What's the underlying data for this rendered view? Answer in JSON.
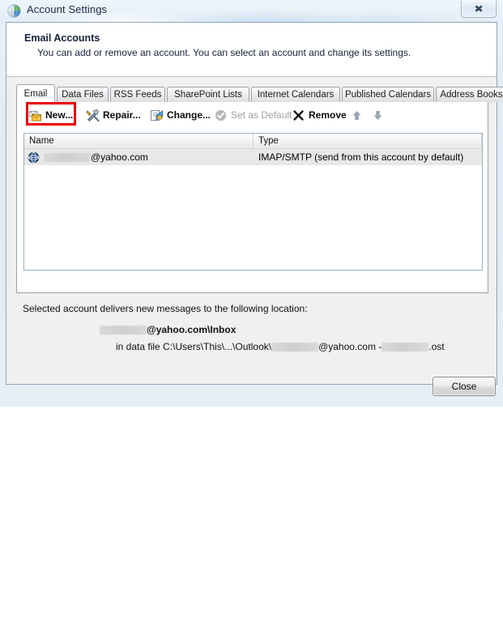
{
  "window": {
    "title": "Account Settings",
    "icon": "outlook-account-settings-icon",
    "close_glyph": "✖"
  },
  "header": {
    "title": "Email Accounts",
    "description": "You can add or remove an account. You can select an account and change its settings."
  },
  "tabs": [
    {
      "label": "Email",
      "selected": true
    },
    {
      "label": "Data Files",
      "selected": false
    },
    {
      "label": "RSS Feeds",
      "selected": false
    },
    {
      "label": "SharePoint Lists",
      "selected": false
    },
    {
      "label": "Internet Calendars",
      "selected": false
    },
    {
      "label": "Published Calendars",
      "selected": false
    },
    {
      "label": "Address Books",
      "selected": false
    }
  ],
  "toolbar": {
    "new_label": "New...",
    "repair_label": "Repair...",
    "change_label": "Change...",
    "set_as_default_label": "Set as Default",
    "remove_label": "Remove",
    "move_up_glyph": "⬆",
    "move_down_glyph": "⬇",
    "highlight_color": "#ee0000"
  },
  "account_list": {
    "columns": [
      "Name",
      "Type"
    ],
    "rows": [
      {
        "name_redacted": true,
        "name_suffix": "@yahoo.com",
        "type": "IMAP/SMTP (send from this account by default)",
        "selected": true,
        "icon": "imap-account-globe-icon"
      }
    ]
  },
  "delivery_info": {
    "caption": "Selected account delivers new messages to the following location:",
    "location_suffix": "@yahoo.com\\Inbox",
    "datafile_prefix": "in data file C:\\Users\\This\\...\\Outlook\\",
    "datafile_middle": "@yahoo.com - ",
    "datafile_suffix": ".ost"
  },
  "footer": {
    "close_label": "Close"
  }
}
